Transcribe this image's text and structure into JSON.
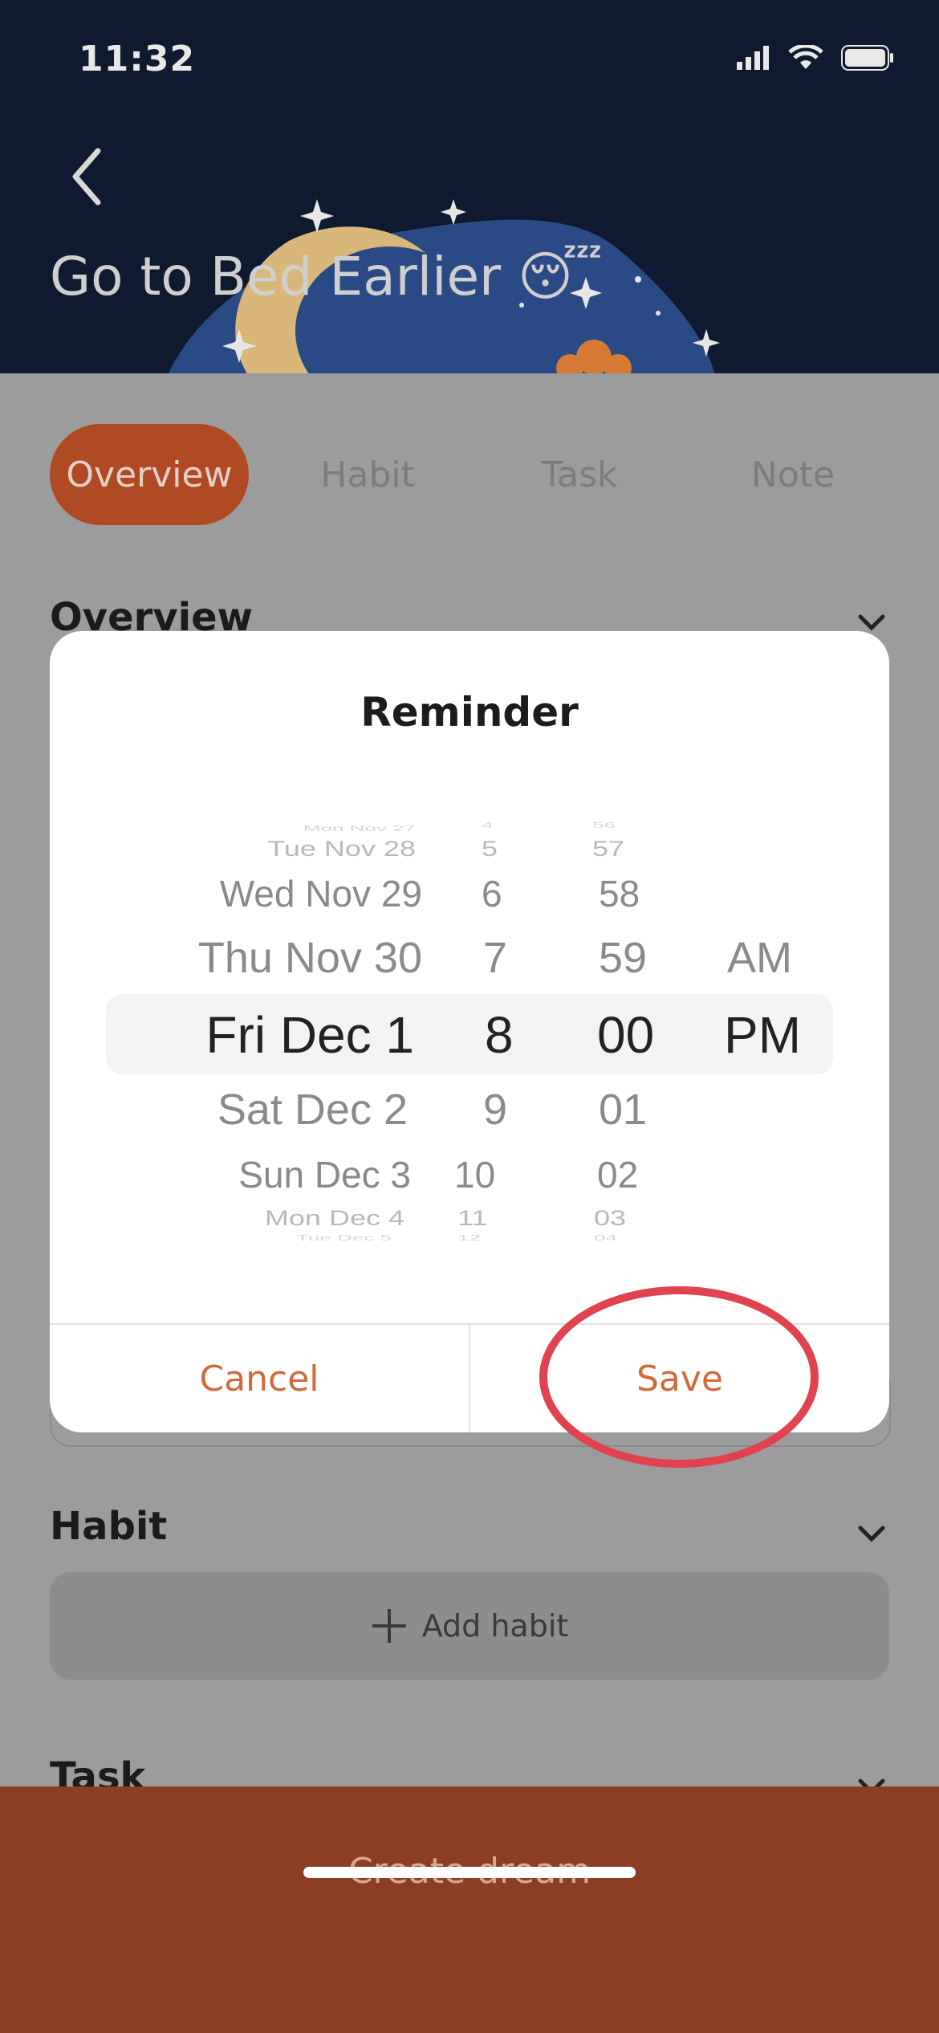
{
  "status_bar": {
    "time": "11:32"
  },
  "header": {
    "title": "Go to Bed Earlier 😴"
  },
  "tabs": [
    {
      "label": "Overview",
      "active": true
    },
    {
      "label": "Habit",
      "active": false
    },
    {
      "label": "Task",
      "active": false
    },
    {
      "label": "Note",
      "active": false
    }
  ],
  "sections": {
    "overview": "Overview",
    "habit": "Habit",
    "task": "Task"
  },
  "add_habit_label": "Add habit",
  "modal": {
    "title": "Reminder",
    "picker": {
      "dates": [
        "Mon Nov 27",
        "Tue Nov 28",
        "Wed Nov 29",
        "Thu Nov 30",
        "Fri Dec 1",
        "Sat Dec 2",
        "Sun Dec 3",
        "Mon Dec 4",
        "Tue Dec 5"
      ],
      "hours": [
        "4",
        "5",
        "6",
        "7",
        "8",
        "9",
        "10",
        "11",
        "12"
      ],
      "minutes": [
        "56",
        "57",
        "58",
        "59",
        "00",
        "01",
        "02",
        "03",
        "04"
      ],
      "ampm": [
        "AM",
        "PM"
      ],
      "selected": {
        "date": "Fri Dec 1",
        "hour": "8",
        "minute": "00",
        "ampm": "PM"
      }
    },
    "cancel_label": "Cancel",
    "save_label": "Save"
  },
  "create_button_label": "Create dream",
  "colors": {
    "accent": "#b04a25",
    "button_text": "#d2693a",
    "highlight_ring": "#e0434f",
    "header_bg": "#0f1a30"
  }
}
